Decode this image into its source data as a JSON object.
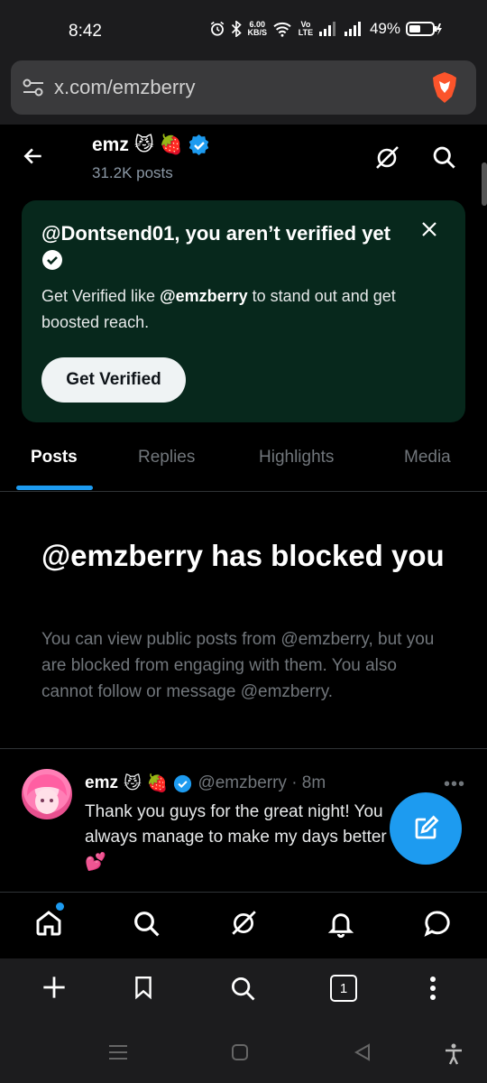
{
  "status": {
    "time": "8:42",
    "net_speed": "6.00",
    "net_unit": "KB/S",
    "volte": "Vo LTE",
    "battery": "49%"
  },
  "browser": {
    "url": "x.com/emzberry",
    "tab_count": "1"
  },
  "profile": {
    "name": "emz",
    "posts_count": "31.2K posts"
  },
  "verify_card": {
    "title": "@Dontsend01, you aren’t verified yet",
    "desc_prefix": "Get Verified like ",
    "desc_handle": "@emzberry",
    "desc_suffix": " to stand out and get boosted reach.",
    "button": "Get Verified"
  },
  "tabs": [
    "Posts",
    "Replies",
    "Highlights",
    "Media"
  ],
  "active_tab": "Posts",
  "blocked": {
    "title": "@emzberry has blocked you",
    "desc": "You can view public posts from @emzberry, but you are blocked from engaging with them. You also cannot follow or message @emzberry."
  },
  "tweet": {
    "name": "emz",
    "handle": "@emzberry · 8m",
    "text": "Thank you guys for the great night! You always manage to make my days better",
    "emoji": "💕"
  },
  "colors": {
    "accent": "#1d9bf0",
    "card_bg": "#07281c",
    "brave": "#fb542b"
  },
  "icons": {
    "name_emojis": [
      "😼",
      "🍓"
    ],
    "verified": "verified-badge-icon"
  }
}
